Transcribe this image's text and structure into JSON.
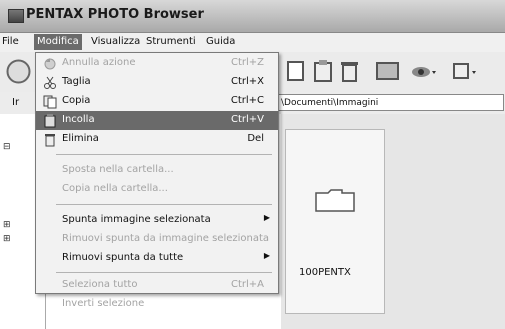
{
  "window": {
    "title": "PENTAX PHOTO Browser"
  },
  "menubar": {
    "items": [
      "File",
      "Modifica",
      "Visualizza",
      "Strumenti",
      "Guida"
    ]
  },
  "addressbar": {
    "left_text": "Ir",
    "path": "\\Documenti\\Immagini"
  },
  "content": {
    "thumbnail_label": "100PENTX"
  },
  "menu": {
    "items": [
      {
        "label": "Annulla azione",
        "shortcut": "Ctrl+Z",
        "icon": "undo-icon",
        "state": "disabled"
      },
      {
        "label": "Taglia",
        "shortcut": "Ctrl+X",
        "icon": "cut-icon",
        "state": "enabled"
      },
      {
        "label": "Copia",
        "shortcut": "Ctrl+C",
        "icon": "copy-icon",
        "state": "enabled"
      },
      {
        "label": "Incolla",
        "shortcut": "Ctrl+V",
        "icon": "paste-icon",
        "state": "highlighted"
      },
      {
        "label": "Elimina",
        "shortcut": "Del",
        "icon": "trash-icon",
        "state": "enabled"
      },
      {
        "label": "Sposta nella cartella...",
        "state": "disabled"
      },
      {
        "label": "Copia nella cartella...",
        "state": "disabled"
      },
      {
        "label": "Spunta immagine selezionata",
        "submenu": true,
        "state": "enabled"
      },
      {
        "label": "Rimuovi spunta da immagine selezionata",
        "state": "disabled"
      },
      {
        "label": "Rimuovi spunta da tutte",
        "submenu": true,
        "state": "enabled"
      },
      {
        "label": "Seleziona tutto",
        "shortcut": "Ctrl+A",
        "state": "disabled"
      },
      {
        "label": "Inverti selezione",
        "state": "disabled"
      }
    ]
  }
}
